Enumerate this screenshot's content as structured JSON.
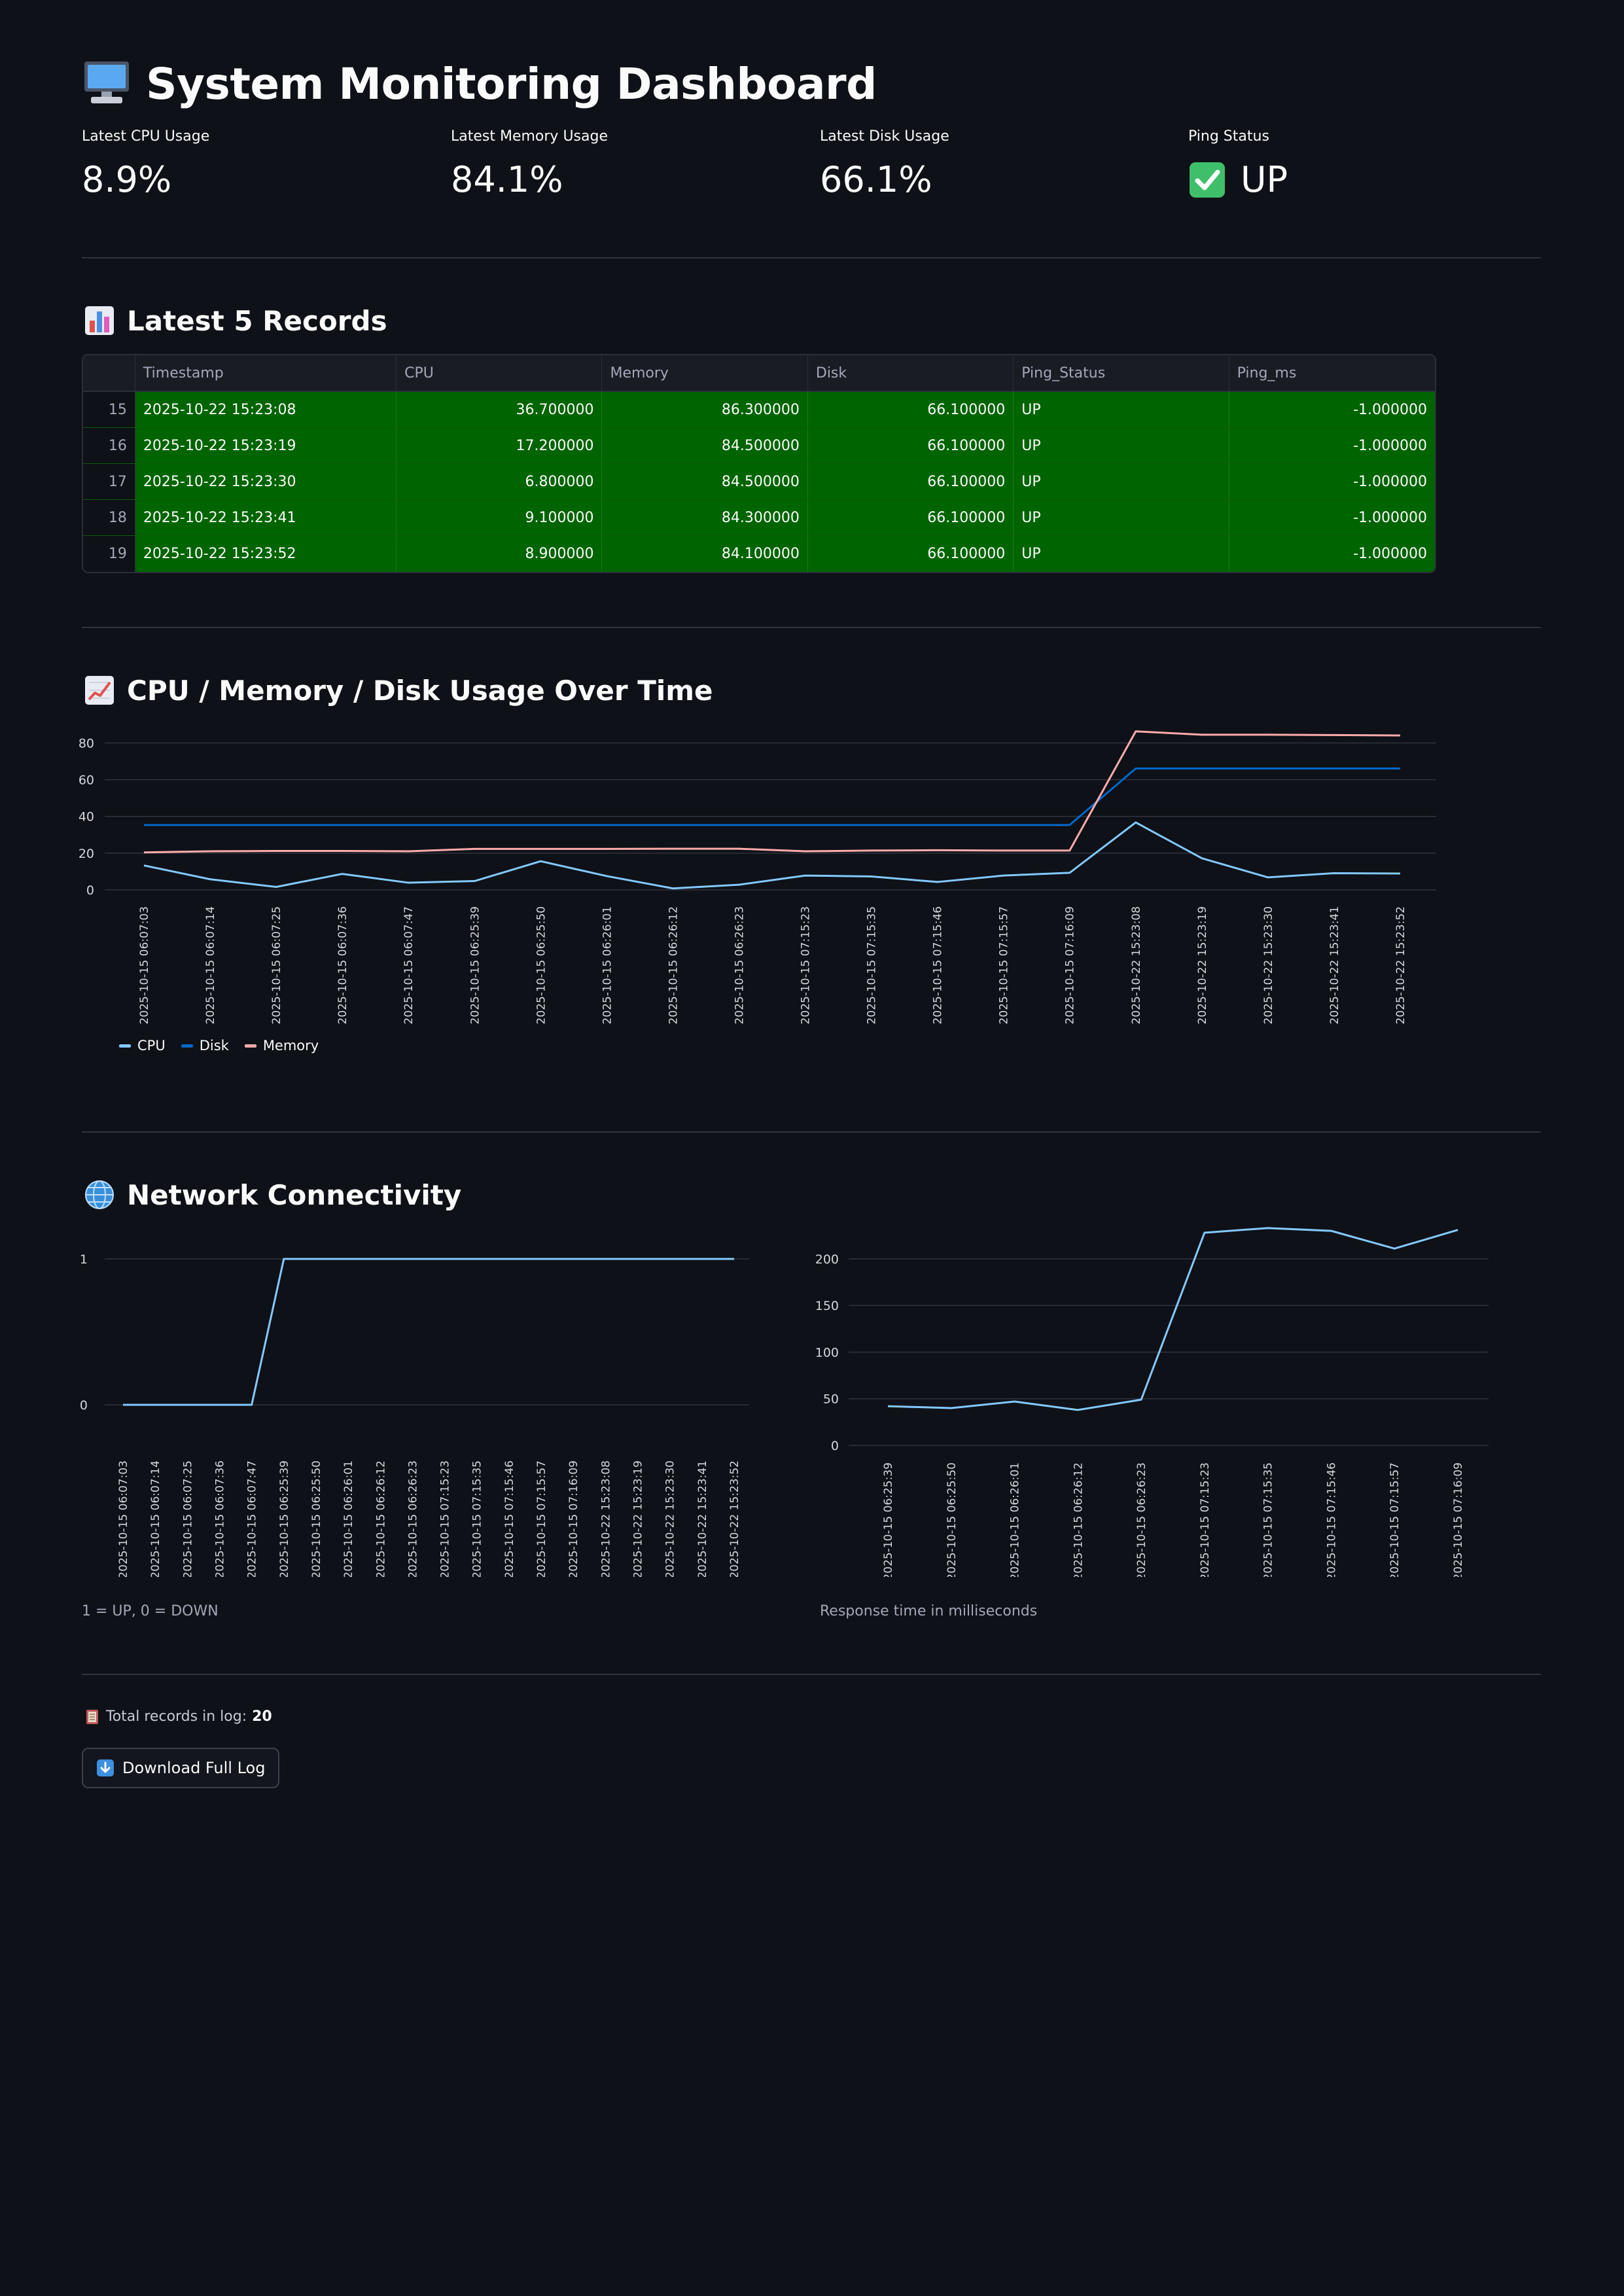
{
  "header": {
    "title": "System Monitoring Dashboard",
    "icon": "desktop-computer-icon"
  },
  "metrics": [
    {
      "label": "Latest CPU Usage",
      "value": "8.9%"
    },
    {
      "label": "Latest Memory Usage",
      "value": "84.1%"
    },
    {
      "label": "Latest Disk Usage",
      "value": "66.1%"
    },
    {
      "label": "Ping Status",
      "value": "UP",
      "icon": "check-mark-icon"
    }
  ],
  "records_section": {
    "title": "Latest 5 Records",
    "icon": "bar-chart-icon",
    "columns": [
      "",
      "Timestamp",
      "CPU",
      "Memory",
      "Disk",
      "Ping_Status",
      "Ping_ms"
    ],
    "rows": [
      {
        "index": "15",
        "timestamp": "2025-10-22 15:23:08",
        "cpu": "36.700000",
        "memory": "86.300000",
        "disk": "66.100000",
        "ping_status": "UP",
        "ping_ms": "-1.000000"
      },
      {
        "index": "16",
        "timestamp": "2025-10-22 15:23:19",
        "cpu": "17.200000",
        "memory": "84.500000",
        "disk": "66.100000",
        "ping_status": "UP",
        "ping_ms": "-1.000000"
      },
      {
        "index": "17",
        "timestamp": "2025-10-22 15:23:30",
        "cpu": "6.800000",
        "memory": "84.500000",
        "disk": "66.100000",
        "ping_status": "UP",
        "ping_ms": "-1.000000"
      },
      {
        "index": "18",
        "timestamp": "2025-10-22 15:23:41",
        "cpu": "9.100000",
        "memory": "84.300000",
        "disk": "66.100000",
        "ping_status": "UP",
        "ping_ms": "-1.000000"
      },
      {
        "index": "19",
        "timestamp": "2025-10-22 15:23:52",
        "cpu": "8.900000",
        "memory": "84.100000",
        "disk": "66.100000",
        "ping_status": "UP",
        "ping_ms": "-1.000000"
      }
    ],
    "row_color": "#006400"
  },
  "usage_section": {
    "title": "CPU / Memory / Disk Usage Over Time",
    "icon": "chart-increasing-icon"
  },
  "network_section": {
    "title": "Network Connectivity",
    "icon": "globe-icon",
    "status_caption": "1 = UP, 0 = DOWN",
    "response_caption": "Response time in milliseconds"
  },
  "footer": {
    "icon": "ledger-icon",
    "total_label": "Total records in log:",
    "total_value": "20",
    "download_label": "Download Full Log",
    "download_icon": "down-arrow-icon"
  },
  "chart_data": [
    {
      "type": "line",
      "x": [
        "2025-10-15 06:07:03",
        "2025-10-15 06:07:14",
        "2025-10-15 06:07:25",
        "2025-10-15 06:07:36",
        "2025-10-15 06:07:47",
        "2025-10-15 06:25:39",
        "2025-10-15 06:25:50",
        "2025-10-15 06:26:01",
        "2025-10-15 06:26:12",
        "2025-10-15 06:26:23",
        "2025-10-15 07:15:23",
        "2025-10-15 07:15:35",
        "2025-10-15 07:15:46",
        "2025-10-15 07:15:57",
        "2025-10-15 07:16:09",
        "2025-10-22 15:23:08",
        "2025-10-22 15:23:19",
        "2025-10-22 15:23:30",
        "2025-10-22 15:23:41",
        "2025-10-22 15:23:52"
      ],
      "series": [
        {
          "name": "CPU",
          "color": "#83c9ff",
          "values": [
            13.3,
            5.8,
            1.6,
            8.7,
            3.9,
            4.8,
            15.6,
            7.5,
            0.8,
            2.8,
            7.8,
            7.3,
            4.3,
            7.8,
            9.3,
            36.7,
            17.2,
            6.8,
            9.1,
            8.9
          ]
        },
        {
          "name": "Disk",
          "color": "#0068c9",
          "values": [
            35.3,
            35.3,
            35.3,
            35.3,
            35.3,
            35.3,
            35.3,
            35.3,
            35.3,
            35.3,
            35.3,
            35.3,
            35.3,
            35.3,
            35.3,
            66.1,
            66.1,
            66.1,
            66.1,
            66.1
          ]
        },
        {
          "name": "Memory",
          "color": "#ffabab",
          "values": [
            20.4,
            21.0,
            21.2,
            21.2,
            21.0,
            22.3,
            22.3,
            22.3,
            22.4,
            22.4,
            21.0,
            21.4,
            21.6,
            21.4,
            21.4,
            86.3,
            84.5,
            84.5,
            84.3,
            84.1
          ]
        }
      ],
      "yticks": [
        0,
        20,
        40,
        60,
        80
      ],
      "ylim": [
        0,
        88
      ],
      "grid": true,
      "legend": "bottom-left"
    },
    {
      "type": "line",
      "x": [
        "2025-10-15 06:07:03",
        "2025-10-15 06:07:14",
        "2025-10-15 06:07:25",
        "2025-10-15 06:07:36",
        "2025-10-15 06:07:47",
        "2025-10-15 06:25:39",
        "2025-10-15 06:25:50",
        "2025-10-15 06:26:01",
        "2025-10-15 06:26:12",
        "2025-10-15 06:26:23",
        "2025-10-15 07:15:23",
        "2025-10-15 07:15:35",
        "2025-10-15 07:15:46",
        "2025-10-15 07:15:57",
        "2025-10-15 07:16:09",
        "2025-10-22 15:23:08",
        "2025-10-22 15:23:19",
        "2025-10-22 15:23:30",
        "2025-10-22 15:23:41",
        "2025-10-22 15:23:52"
      ],
      "series": [
        {
          "color": "#83c9ff",
          "values": [
            0,
            0,
            0,
            0,
            0,
            1,
            1,
            1,
            1,
            1,
            1,
            1,
            1,
            1,
            1,
            1,
            1,
            1,
            1,
            1
          ]
        }
      ],
      "yticks": [
        0,
        1
      ],
      "ylim": [
        0,
        1
      ],
      "grid": true
    },
    {
      "type": "line",
      "x": [
        "2025-10-15 06:25:39",
        "2025-10-15 06:25:50",
        "2025-10-15 06:26:01",
        "2025-10-15 06:26:12",
        "2025-10-15 06:26:23",
        "2025-10-15 07:15:23",
        "2025-10-15 07:15:35",
        "2025-10-15 07:15:46",
        "2025-10-15 07:15:57",
        "2025-10-15 07:16:09"
      ],
      "series": [
        {
          "color": "#83c9ff",
          "values": [
            42,
            40,
            47,
            38,
            49,
            228,
            233,
            230,
            211,
            231
          ]
        }
      ],
      "yticks": [
        0,
        50,
        100,
        150,
        200
      ],
      "ylim": [
        0,
        235
      ],
      "grid": true
    }
  ]
}
